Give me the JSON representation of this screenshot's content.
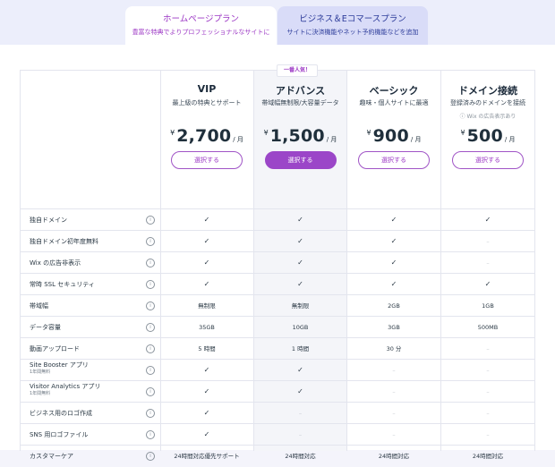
{
  "tabs": [
    {
      "title": "ホームページプラン",
      "subtitle": "豊富な特典でよりプロフェッショナルなサイトに"
    },
    {
      "title": "ビジネス＆Eコマースプラン",
      "subtitle": "サイトに決済機能やネット予約機能などを追加"
    }
  ],
  "badge": "一番人気！",
  "plans": [
    {
      "name": "VIP",
      "desc": "最上級の特典とサポート",
      "note": "",
      "currency": "¥",
      "price": "2,700",
      "unit": "/ 月",
      "cta": "選択する"
    },
    {
      "name": "アドバンス",
      "desc": "帯域幅無制限/大容量データ",
      "note": "",
      "currency": "¥",
      "price": "1,500",
      "unit": "/ 月",
      "cta": "選択する"
    },
    {
      "name": "ベーシック",
      "desc": "趣味・個人サイトに最適",
      "note": "",
      "currency": "¥",
      "price": "900",
      "unit": "/ 月",
      "cta": "選択する"
    },
    {
      "name": "ドメイン接続",
      "desc": "登録済みのドメインを接続",
      "note": "Wix の広告表示あり",
      "currency": "¥",
      "price": "500",
      "unit": "/ 月",
      "cta": "選択する"
    }
  ],
  "info_glyph": "i",
  "features": [
    {
      "label": "独自ドメイン",
      "sub": "",
      "values": [
        "✓",
        "✓",
        "✓",
        "✓"
      ]
    },
    {
      "label": "独自ドメイン初年度無料",
      "sub": "",
      "values": [
        "✓",
        "✓",
        "✓",
        "–"
      ]
    },
    {
      "label": "Wix の広告非表示",
      "sub": "",
      "values": [
        "✓",
        "✓",
        "✓",
        "–"
      ]
    },
    {
      "label": "常時 SSL セキュリティ",
      "sub": "",
      "values": [
        "✓",
        "✓",
        "✓",
        "✓"
      ]
    },
    {
      "label": "帯域幅",
      "sub": "",
      "values": [
        "無制限",
        "無制限",
        "2GB",
        "1GB"
      ]
    },
    {
      "label": "データ容量",
      "sub": "",
      "values": [
        "35GB",
        "10GB",
        "3GB",
        "500MB"
      ]
    },
    {
      "label": "動画アップロード",
      "sub": "",
      "values": [
        "5 時間",
        "1 時間",
        "30 分",
        "–"
      ]
    },
    {
      "label": "Site Booster アプリ",
      "sub": "1年間無料",
      "values": [
        "✓",
        "✓",
        "–",
        "–"
      ]
    },
    {
      "label": "Visitor Analytics アプリ",
      "sub": "1年間無料",
      "values": [
        "✓",
        "✓",
        "–",
        "–"
      ]
    },
    {
      "label": "ビジネス用のロゴ作成",
      "sub": "",
      "values": [
        "✓",
        "–",
        "–",
        "–"
      ]
    },
    {
      "label": "SNS 用ロゴファイル",
      "sub": "",
      "values": [
        "✓",
        "–",
        "–",
        "–"
      ]
    },
    {
      "label": "カスタマーケア",
      "sub": "",
      "values": [
        "24時間対応優先サポート",
        "24時間対応",
        "24時間対応",
        "24時間対応"
      ]
    }
  ],
  "colors": {
    "accent": "#9b46c8",
    "tab_active_text": "#9b36c4",
    "tab_inactive_bg": "#d9dcf8"
  }
}
